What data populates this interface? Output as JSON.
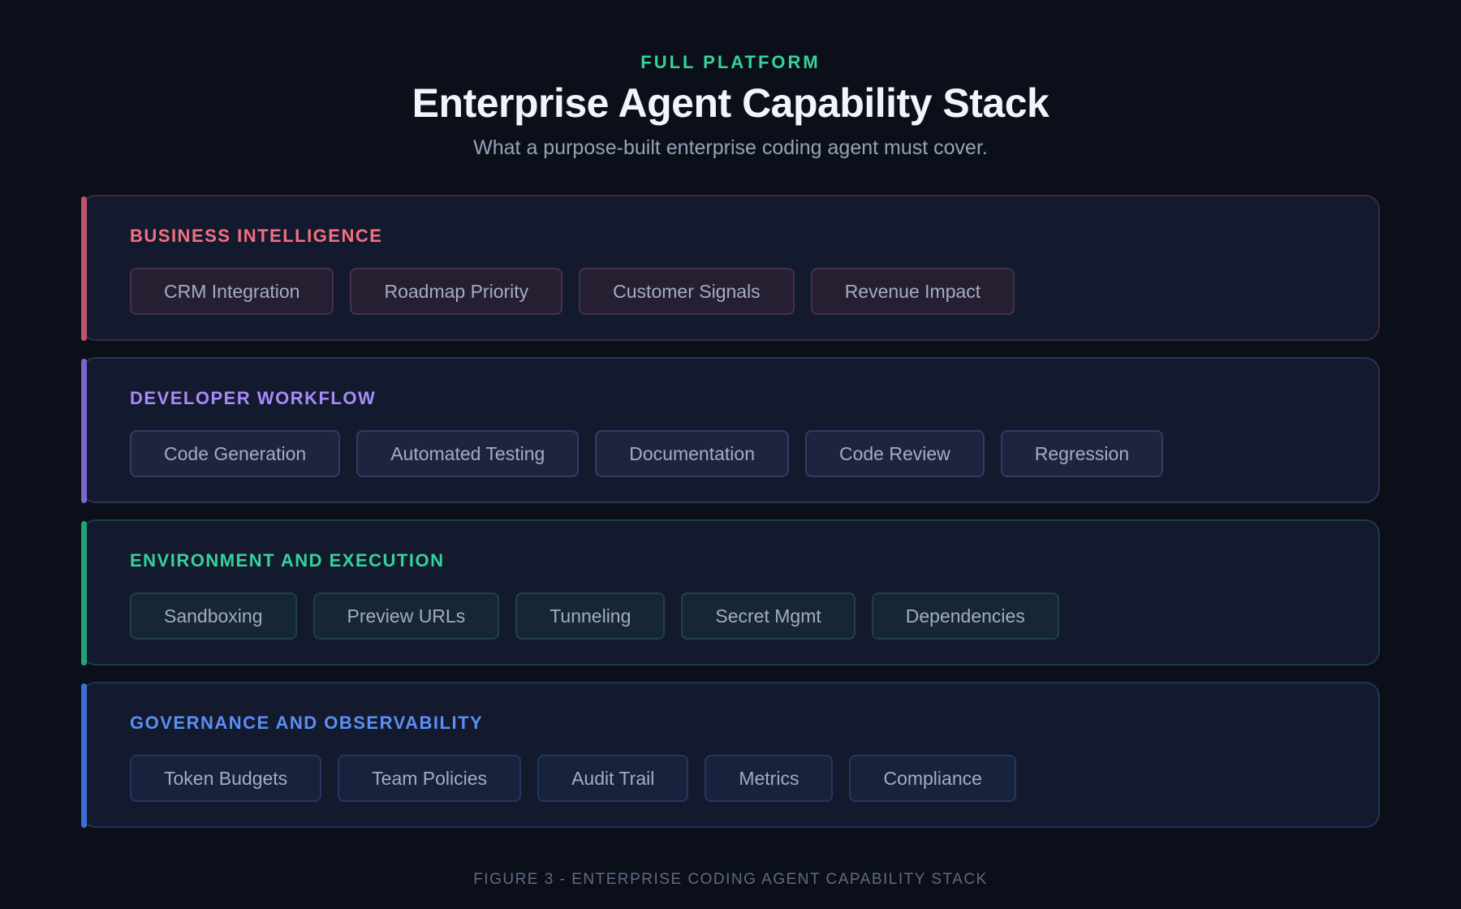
{
  "header": {
    "eyebrow": "FULL PLATFORM",
    "title": "Enterprise Agent Capability Stack",
    "subtitle": "What a purpose-built enterprise coding agent must cover."
  },
  "layers": [
    {
      "title": "BUSINESS INTELLIGENCE",
      "accent": "#f4707f",
      "chips": [
        "CRM Integration",
        "Roadmap Priority",
        "Customer Signals",
        "Revenue Impact"
      ]
    },
    {
      "title": "DEVELOPER WORKFLOW",
      "accent": "#a78bfa",
      "chips": [
        "Code Generation",
        "Automated Testing",
        "Documentation",
        "Code Review",
        "Regression"
      ]
    },
    {
      "title": "ENVIRONMENT AND EXECUTION",
      "accent": "#34d399",
      "chips": [
        "Sandboxing",
        "Preview URLs",
        "Tunneling",
        "Secret Mgmt",
        "Dependencies"
      ]
    },
    {
      "title": "GOVERNANCE AND OBSERVABILITY",
      "accent": "#5b8ff6",
      "chips": [
        "Token Budgets",
        "Team Policies",
        "Audit Trail",
        "Metrics",
        "Compliance"
      ]
    }
  ],
  "caption": "FIGURE 3 - ENTERPRISE CODING AGENT CAPABILITY STACK"
}
